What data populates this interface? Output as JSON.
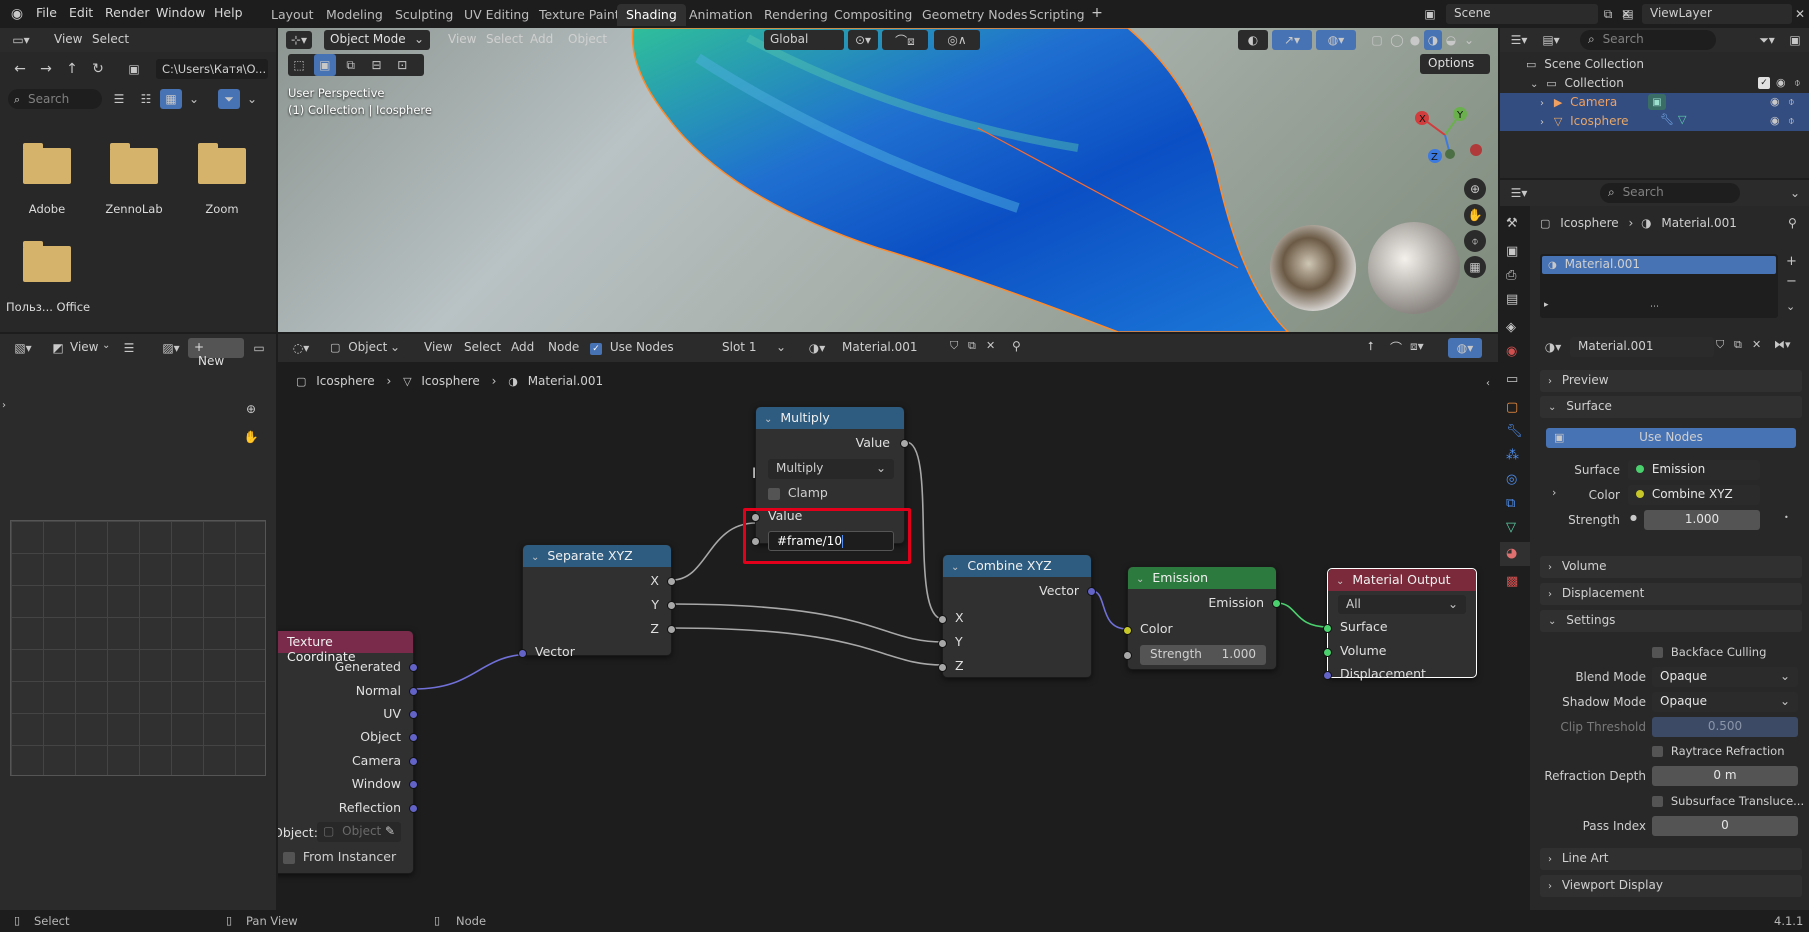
{
  "topbar": {
    "menus": [
      "File",
      "Edit",
      "Render",
      "Window",
      "Help"
    ],
    "workspaces": [
      "Layout",
      "Modeling",
      "Sculpting",
      "UV Editing",
      "Texture Paint",
      "Shading",
      "Animation",
      "Rendering",
      "Compositing",
      "Geometry Nodes",
      "Scripting"
    ],
    "active_workspace": "Shading",
    "scene": "Scene",
    "view_layer": "ViewLayer"
  },
  "file_browser": {
    "menus": [
      "View",
      "Select"
    ],
    "path": "C:\\Users\\Катя\\O...",
    "search_placeholder": "Search",
    "folders": [
      "Adobe",
      "ZennoLab",
      "Zoom",
      "Польз... Office"
    ]
  },
  "viewport": {
    "mode": "Object Mode",
    "menus": [
      "View",
      "Select",
      "Add",
      "Object"
    ],
    "transform": "Global",
    "options": "Options",
    "perspective": "User Perspective",
    "collection_label": "(1) Collection | Icosphere"
  },
  "outliner": {
    "search_placeholder": "Search",
    "scene_collection": "Scene Collection",
    "collection": "Collection",
    "camera": "Camera",
    "icosphere": "Icosphere"
  },
  "image_editor": {
    "view": "View",
    "new": "New"
  },
  "node_editor": {
    "editor_type": "Object",
    "menus": [
      "View",
      "Select",
      "Add",
      "Node"
    ],
    "use_nodes": "Use Nodes",
    "slot": "Slot 1",
    "material": "Material.001",
    "breadcrumb": [
      "Icosphere",
      "Icosphere",
      "Material.001"
    ]
  },
  "nodes": {
    "multiply": {
      "title": "Multiply",
      "out": "Value",
      "op": "Multiply",
      "clamp": "Clamp",
      "in_value": "Value",
      "expr": "#frame/10"
    },
    "separate": {
      "title": "Separate XYZ",
      "x": "X",
      "y": "Y",
      "z": "Z",
      "vector": "Vector"
    },
    "combine": {
      "title": "Combine XYZ",
      "vector": "Vector",
      "x": "X",
      "y": "Y",
      "z": "Z"
    },
    "emission": {
      "title": "Emission",
      "out": "Emission",
      "color": "Color",
      "strength_label": "Strength",
      "strength": "1.000"
    },
    "output": {
      "title": "Material Output",
      "target": "All",
      "surface": "Surface",
      "volume": "Volume",
      "displacement": "Displacement"
    },
    "texcoord": {
      "title": "Texture Coordinate",
      "outputs": [
        "Generated",
        "Normal",
        "UV",
        "Object",
        "Camera",
        "Window",
        "Reflection"
      ],
      "object_label": "Object:",
      "object_placeholder": "Object",
      "from_instancer": "From Instancer"
    }
  },
  "properties": {
    "search_placeholder": "Search",
    "object": "Icosphere",
    "material": "Material.001",
    "slot_item": "Material.001",
    "material_field": "Material.001",
    "sections": {
      "preview": "Preview",
      "surface": "Surface",
      "volume": "Volume",
      "displacement": "Displacement",
      "settings": "Settings",
      "line_art": "Line Art",
      "viewport_display": "Viewport Display"
    },
    "use_nodes": "Use Nodes",
    "surface_label": "Surface",
    "surface_value": "Emission",
    "color_label": "Color",
    "color_value": "Combine XYZ",
    "strength_label": "Strength",
    "strength_value": "1.000",
    "backface": "Backface Culling",
    "blend_label": "Blend Mode",
    "blend_value": "Opaque",
    "shadow_label": "Shadow Mode",
    "shadow_value": "Opaque",
    "clip_label": "Clip Threshold",
    "clip_value": "0.500",
    "raytrace": "Raytrace Refraction",
    "refr_label": "Refraction Depth",
    "refr_value": "0 m",
    "sss": "Subsurface Transluce...",
    "pass_label": "Pass Index",
    "pass_value": "0"
  },
  "statusbar": {
    "select": "Select",
    "pan": "Pan View",
    "node": "Node",
    "version": "4.1.1"
  },
  "colors": {
    "accent": "#4772b3",
    "highlight": "#e3001b",
    "camera_text": "#f0a060",
    "icosphere_text": "#e6a76a"
  }
}
